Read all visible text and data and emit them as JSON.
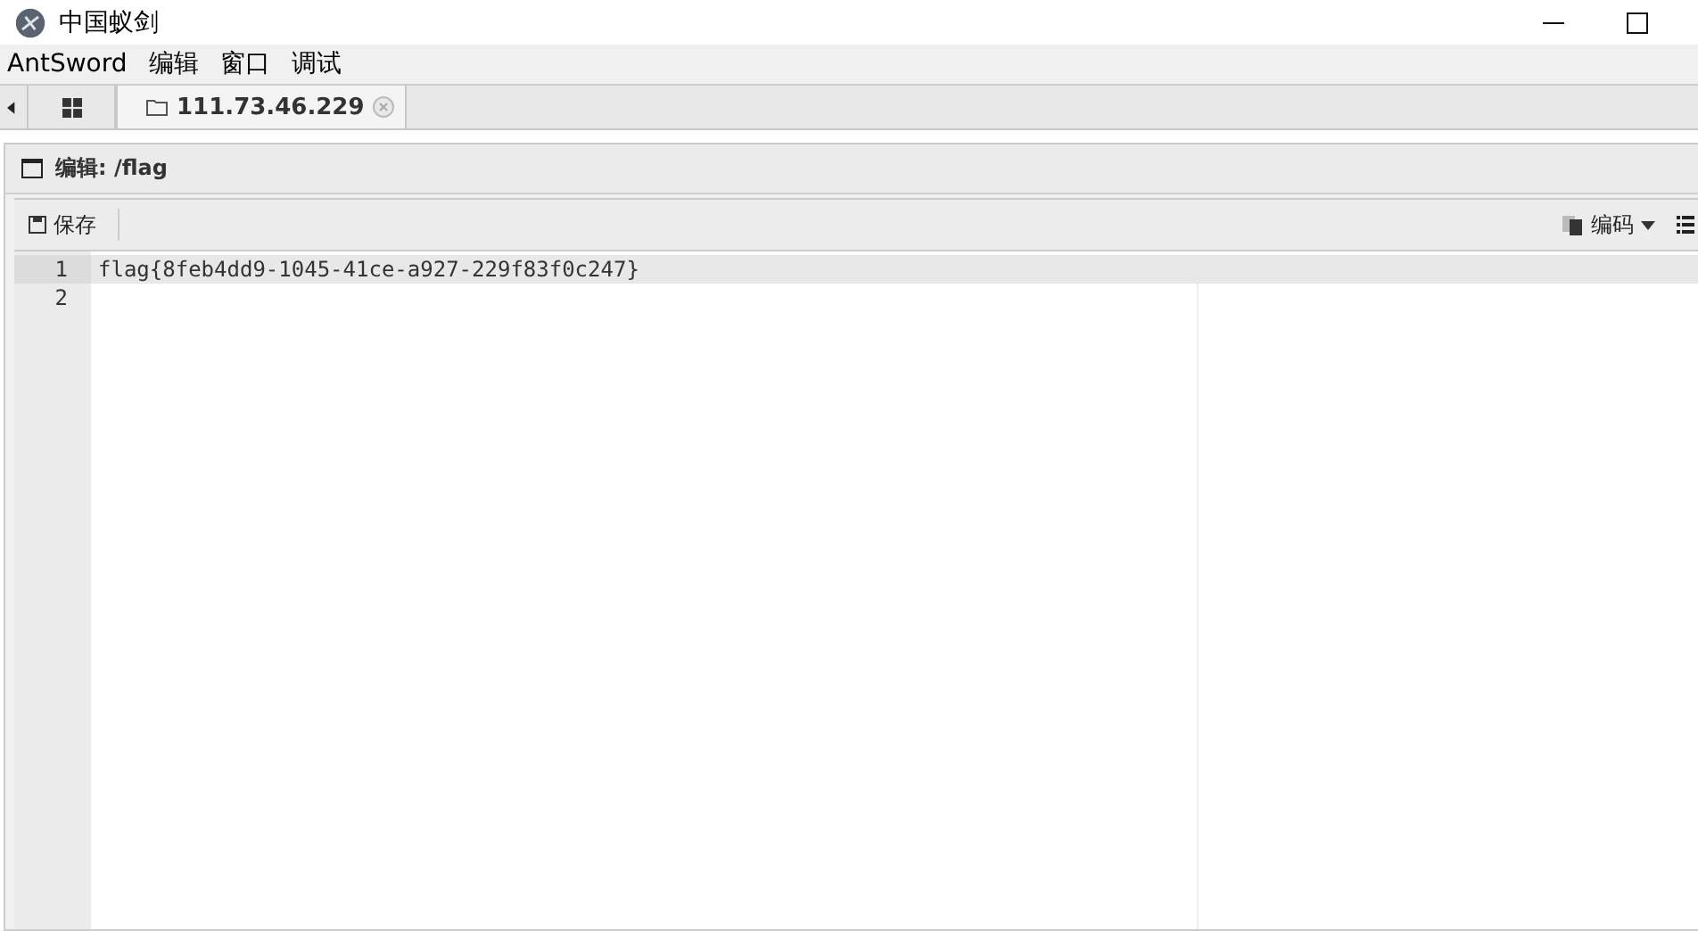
{
  "window": {
    "title": "中国蚁剑"
  },
  "menu": [
    "AntSword",
    "编辑",
    "窗口",
    "调试"
  ],
  "tabs": [
    {
      "kind": "home",
      "selected": false
    },
    {
      "kind": "host",
      "label": "111.73.46.229",
      "selected": true
    }
  ],
  "panel": {
    "title": "编辑: /flag"
  },
  "toolbar": {
    "save": "保存",
    "encoding": "编码"
  },
  "editor": {
    "lines": [
      {
        "number": "1",
        "text": "flag{8feb4dd9-1045-41ce-a927-229f83f0c247}",
        "active": true
      },
      {
        "number": "2",
        "active": false
      }
    ]
  }
}
